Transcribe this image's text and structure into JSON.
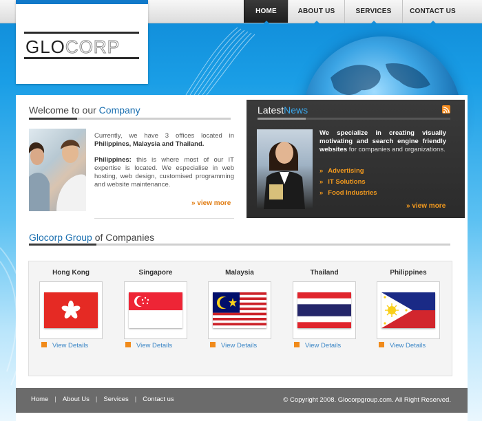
{
  "nav": {
    "items": [
      {
        "label": "HOME",
        "active": true
      },
      {
        "label": "ABOUT US",
        "active": false
      },
      {
        "label": "SERVICES",
        "active": false
      },
      {
        "label": "CONTACT US",
        "active": false
      }
    ]
  },
  "logo": {
    "text_dark": "GLO",
    "text_light": "CORP"
  },
  "welcome": {
    "heading_plain": "Welcome to our ",
    "heading_highlight": "Company",
    "para1_plain": "Currently, we have 3 offices located in ",
    "para1_bold": "Philippines, Malaysia and Thailand.",
    "para2_bold": "Philippines:",
    "para2_plain": " this is where most of our IT expertise is located. We especialise in web hosting, web design, customised programming and website maintenance.",
    "view_more": "» view more"
  },
  "news": {
    "heading_plain": "Latest",
    "heading_highlight": "News",
    "intro_bold": "We specialize in creating visually motivating and search engine friendly websites",
    "intro_plain": " for companies and organizations.",
    "items": [
      "Advertising",
      "IT Solutions",
      "Food Industries"
    ],
    "bullet": "»",
    "view_more": "» view more"
  },
  "group": {
    "heading_highlight": "Glocorp Group",
    "heading_plain": " of Companies",
    "countries": [
      {
        "name": "Hong Kong",
        "flag": "hong-kong"
      },
      {
        "name": "Singapore",
        "flag": "singapore"
      },
      {
        "name": "Malaysia",
        "flag": "malaysia"
      },
      {
        "name": "Thailand",
        "flag": "thailand"
      },
      {
        "name": "Philippines",
        "flag": "philippines"
      }
    ],
    "details_label": "View Details"
  },
  "footer": {
    "links": [
      "Home",
      "About Us",
      "Services",
      "Contact us"
    ],
    "copyright": "© Copyright 2008. Glocorpgroup.com. All Right Reserved."
  },
  "colors": {
    "accent_blue": "#1a6fb0",
    "orange": "#e07b10",
    "footer_gray": "#6b6b6b"
  }
}
